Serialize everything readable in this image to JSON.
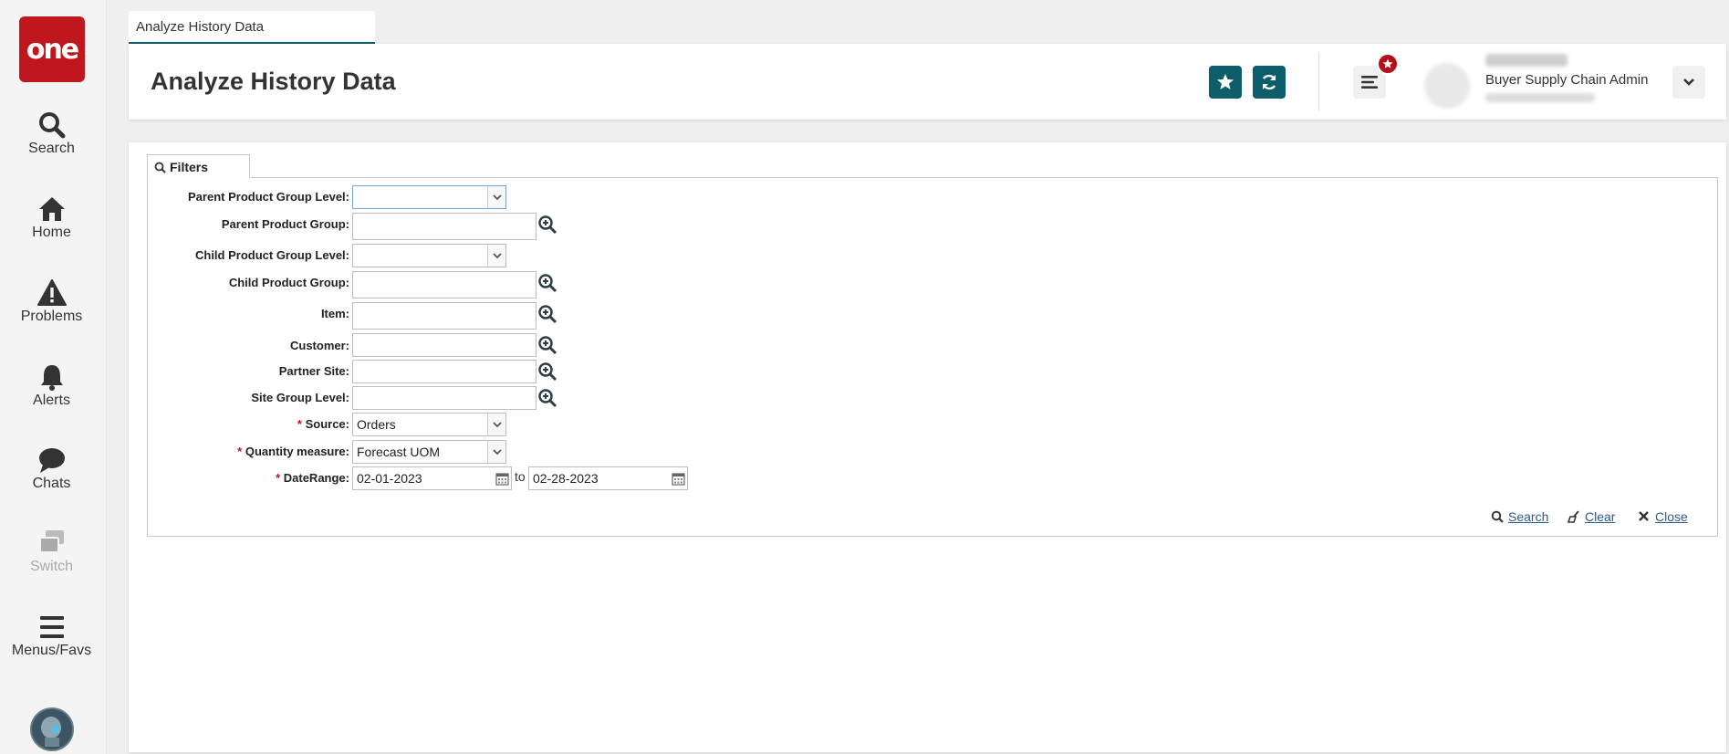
{
  "nav": {
    "logo_text": "one",
    "items": [
      {
        "label": "Search",
        "icon": "search-icon"
      },
      {
        "label": "Home",
        "icon": "home-icon"
      },
      {
        "label": "Problems",
        "icon": "warning-icon"
      },
      {
        "label": "Alerts",
        "icon": "bell-icon"
      },
      {
        "label": "Chats",
        "icon": "chat-icon"
      },
      {
        "label": "Switch",
        "icon": "switch-icon",
        "disabled": true
      },
      {
        "label": "Menus/Favs",
        "icon": "hamburger-icon"
      }
    ]
  },
  "tab": {
    "label": "Analyze History Data"
  },
  "header": {
    "title": "Analyze History Data",
    "user": {
      "role": "Buyer Supply Chain Admin"
    }
  },
  "filters": {
    "tab_label": "Filters",
    "fields": {
      "parent_product_group_level": {
        "label": "Parent Product Group Level:",
        "value": ""
      },
      "parent_product_group": {
        "label": "Parent Product Group:",
        "value": ""
      },
      "child_product_group_level": {
        "label": "Child Product Group Level:",
        "value": ""
      },
      "child_product_group": {
        "label": "Child Product Group:",
        "value": ""
      },
      "item": {
        "label": "Item:",
        "value": ""
      },
      "customer": {
        "label": "Customer:",
        "value": ""
      },
      "partner_site": {
        "label": "Partner Site:",
        "value": ""
      },
      "site_group_level": {
        "label": "Site Group Level:",
        "value": ""
      },
      "source": {
        "label": "Source:",
        "value": "Orders",
        "required": "*"
      },
      "quantity_measure": {
        "label": "Quantity measure:",
        "value": "Forecast UOM",
        "required": "*"
      },
      "date_range": {
        "label": "DateRange:",
        "required": "*",
        "from": "02-01-2023",
        "to_label": "to",
        "to": "02-28-2023"
      }
    },
    "actions": {
      "search": "Search",
      "clear": "Clear",
      "close": "Close"
    }
  },
  "colors": {
    "brand_red": "#c0161d",
    "accent_teal": "#0d5e6a",
    "link_blue": "#2a5d8a"
  }
}
